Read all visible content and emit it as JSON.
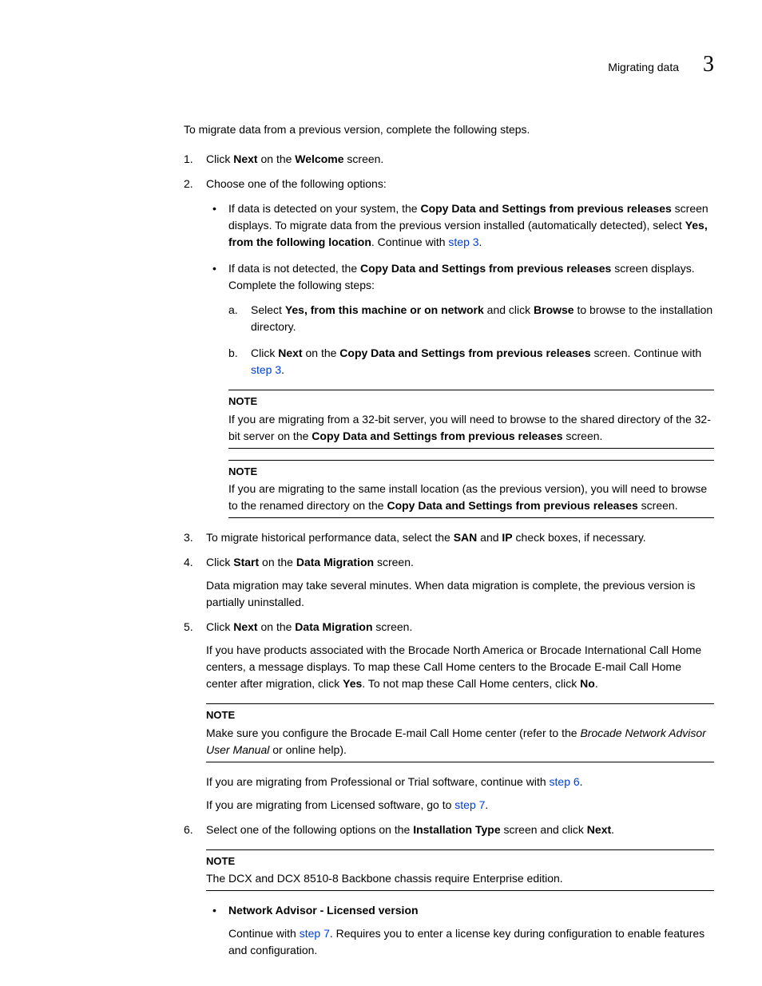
{
  "header": {
    "title": "Migrating data",
    "chapter": "3"
  },
  "intro": "To migrate data from a previous version, complete the following steps.",
  "step1": {
    "num": "1.",
    "t1": "Click ",
    "b1": "Next",
    "t2": " on the ",
    "b2": "Welcome",
    "t3": " screen."
  },
  "step2": {
    "num": "2.",
    "text": "Choose one of the following options:",
    "bul1": {
      "t1": "If data is detected on your system, the ",
      "b1": "Copy Data and Settings from previous releases",
      "t2": " screen displays. To migrate data from the previous version installed (automatically detected), select ",
      "b2": "Yes, from the following location",
      "t3": ". Continue with ",
      "link": "step 3",
      "t4": "."
    },
    "bul2": {
      "t1": "If data is not detected, the ",
      "b1": "Copy Data and Settings from previous releases",
      "t2": " screen displays. Complete the following steps:",
      "a": {
        "alpha": "a.",
        "t1": "Select ",
        "b1": "Yes, from this machine or on network",
        "t2": " and click ",
        "b2": "Browse",
        "t3": " to browse to the installation directory."
      },
      "b": {
        "alpha": "b.",
        "t1": "Click ",
        "b1": "Next",
        "t2": " on the ",
        "b2": "Copy Data and Settings from previous releases",
        "t3": " screen. Continue with ",
        "link": "step 3",
        "t4": "."
      }
    },
    "note1": {
      "title": "NOTE",
      "t1": "If you are migrating from a 32-bit server, you will need to browse to the shared directory of the 32-bit server on the ",
      "b1": "Copy Data and Settings from previous releases",
      "t2": " screen."
    },
    "note2": {
      "title": "NOTE",
      "t1": "If you are migrating to the same install location (as the previous version), you will need to browse to the renamed directory on the ",
      "b1": "Copy Data and Settings from previous releases",
      "t2": " screen."
    }
  },
  "step3": {
    "num": "3.",
    "t1": "To migrate historical performance data, select the ",
    "b1": "SAN",
    "t2": " and ",
    "b2": "IP",
    "t3": " check boxes, if necessary."
  },
  "step4": {
    "num": "4.",
    "t1": "Click ",
    "b1": "Start",
    "t2": " on the ",
    "b2": "Data Migration",
    "t3": " screen.",
    "para": "Data migration may take several minutes. When data migration is complete, the previous version is partially uninstalled."
  },
  "step5": {
    "num": "5.",
    "t1": "Click ",
    "b1": "Next",
    "t2": " on the ",
    "b2": "Data Migration",
    "t3": " screen.",
    "para": {
      "t1": "If you have products associated with the Brocade North America or Brocade International Call Home centers, a message displays. To map these Call Home centers to the Brocade E-mail Call Home center after migration, click ",
      "b1": "Yes",
      "t2": ". To not map these Call Home centers, click ",
      "b2": "No",
      "t3": "."
    },
    "note": {
      "title": "NOTE",
      "t1": "Make sure you configure the Brocade E-mail Call Home center (refer to the ",
      "i1": "Brocade Network Advisor User Manual",
      "t2": " or online help)."
    },
    "p2": {
      "t1": "If you are migrating from Professional or Trial software, continue with ",
      "link": "step 6",
      "t2": "."
    },
    "p3": {
      "t1": "If you are migrating from Licensed software, go to ",
      "link": "step 7",
      "t2": "."
    }
  },
  "step6": {
    "num": "6.",
    "t1": "Select one of the following options on the ",
    "b1": "Installation Type",
    "t2": " screen and click ",
    "b2": "Next",
    "t3": ".",
    "note": {
      "title": "NOTE",
      "text": "The DCX and DCX 8510-8 Backbone chassis require Enterprise edition."
    },
    "bul1": {
      "title": "Network Advisor - Licensed version",
      "t1": "Continue with ",
      "link": "step 7",
      "t2": ". Requires you to enter a license key during configuration to enable features and configuration."
    }
  }
}
